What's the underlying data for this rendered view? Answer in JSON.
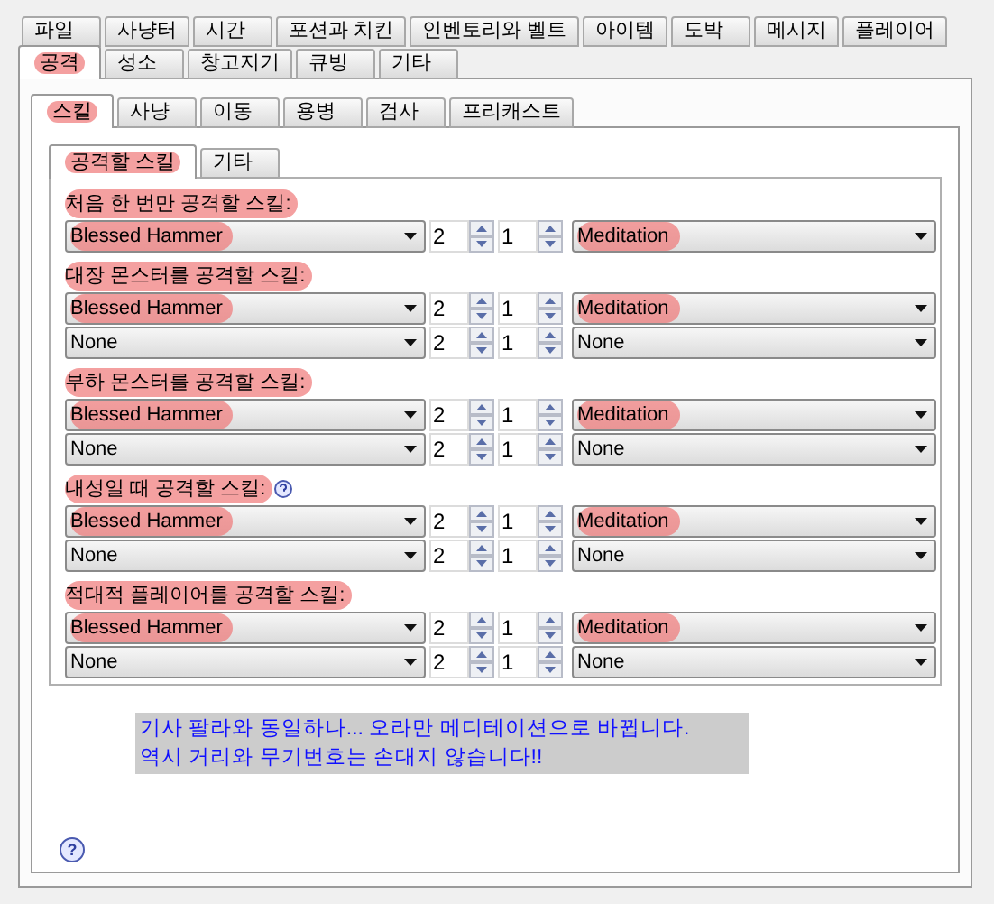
{
  "top_tabs_row_1": [
    {
      "label": "파일",
      "selected": false,
      "highlighted": false
    },
    {
      "label": "사냥터",
      "selected": false,
      "highlighted": false
    },
    {
      "label": "시간",
      "selected": false,
      "highlighted": false
    },
    {
      "label": "포션과 치킨",
      "selected": false,
      "highlighted": false
    },
    {
      "label": "인벤토리와 벨트",
      "selected": false,
      "highlighted": false
    },
    {
      "label": "아이템",
      "selected": false,
      "highlighted": false
    },
    {
      "label": "도박",
      "selected": false,
      "highlighted": false
    },
    {
      "label": "메시지",
      "selected": false,
      "highlighted": false
    },
    {
      "label": "플레이어",
      "selected": false,
      "highlighted": false
    }
  ],
  "top_tabs_row_2": [
    {
      "label": "공격",
      "selected": true,
      "highlighted": true
    },
    {
      "label": "성소",
      "selected": false,
      "highlighted": false
    },
    {
      "label": "창고지기",
      "selected": false,
      "highlighted": false
    },
    {
      "label": "큐빙",
      "selected": false,
      "highlighted": false
    },
    {
      "label": "기타",
      "selected": false,
      "highlighted": false
    }
  ],
  "attack_tabs": [
    {
      "label": "스킬",
      "selected": true,
      "highlighted": true
    },
    {
      "label": "사냥",
      "selected": false,
      "highlighted": false
    },
    {
      "label": "이동",
      "selected": false,
      "highlighted": false
    },
    {
      "label": "용병",
      "selected": false,
      "highlighted": false
    },
    {
      "label": "검사",
      "selected": false,
      "highlighted": false
    },
    {
      "label": "프리캐스트",
      "selected": false,
      "highlighted": false
    }
  ],
  "skill_tabs": [
    {
      "label": "공격할 스킬",
      "selected": true,
      "highlighted": true
    },
    {
      "label": "기타",
      "selected": false,
      "highlighted": false
    }
  ],
  "groups": [
    {
      "label": "처음 한 번만 공격할 스킬:",
      "highlighted": true,
      "help": false,
      "rows": [
        {
          "skill": "Blessed Hammer",
          "skill_highlighted": true,
          "value_1": "2",
          "value_2": "1",
          "aura": "Meditation",
          "aura_highlighted": true
        }
      ]
    },
    {
      "label": "대장 몬스터를 공격할 스킬:",
      "highlighted": true,
      "help": false,
      "rows": [
        {
          "skill": "Blessed Hammer",
          "skill_highlighted": true,
          "value_1": "2",
          "value_2": "1",
          "aura": "Meditation",
          "aura_highlighted": true
        },
        {
          "skill": "None",
          "skill_highlighted": false,
          "value_1": "2",
          "value_2": "1",
          "aura": "None",
          "aura_highlighted": false
        }
      ]
    },
    {
      "label": "부하 몬스터를 공격할 스킬:",
      "highlighted": true,
      "help": false,
      "rows": [
        {
          "skill": "Blessed Hammer",
          "skill_highlighted": true,
          "value_1": "2",
          "value_2": "1",
          "aura": "Meditation",
          "aura_highlighted": true
        },
        {
          "skill": "None",
          "skill_highlighted": false,
          "value_1": "2",
          "value_2": "1",
          "aura": "None",
          "aura_highlighted": false
        }
      ]
    },
    {
      "label": "내성일 때 공격할 스킬:",
      "highlighted": true,
      "help": true,
      "rows": [
        {
          "skill": "Blessed Hammer",
          "skill_highlighted": true,
          "value_1": "2",
          "value_2": "1",
          "aura": "Meditation",
          "aura_highlighted": true
        },
        {
          "skill": "None",
          "skill_highlighted": false,
          "value_1": "2",
          "value_2": "1",
          "aura": "None",
          "aura_highlighted": false
        }
      ]
    },
    {
      "label": "적대적 플레이어를 공격할 스킬:",
      "highlighted": true,
      "help": false,
      "rows": [
        {
          "skill": "Blessed Hammer",
          "skill_highlighted": true,
          "value_1": "2",
          "value_2": "1",
          "aura": "Meditation",
          "aura_highlighted": true
        },
        {
          "skill": "None",
          "skill_highlighted": false,
          "value_1": "2",
          "value_2": "1",
          "aura": "None",
          "aura_highlighted": false
        }
      ]
    }
  ],
  "note": {
    "lines": [
      "기사 팔라와 동일하나... 오라만 메디테이션으로 바뀝니다.",
      "역시 거리와 무기번호는 손대지 않습니다!!"
    ]
  },
  "help_button": {
    "label": "?"
  }
}
